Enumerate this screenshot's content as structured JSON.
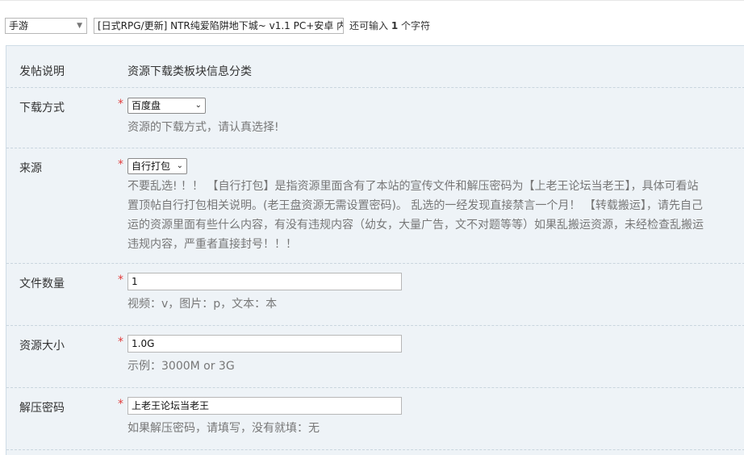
{
  "top": {
    "category_select": "手游",
    "title_value": "[日式RPG/更新] NTR纯爱陷阱地下城~ v1.1 PC+安卓 内i",
    "counter_prefix": "还可输入",
    "counter_number": "1",
    "counter_suffix": "个字符"
  },
  "fields": {
    "post_info": {
      "label": "发帖说明",
      "text": "资源下载类板块信息分类"
    },
    "download_method": {
      "label": "下载方式",
      "required": "*",
      "value": "百度盘",
      "hint": "资源的下载方式，请认真选择!"
    },
    "source": {
      "label": "来源",
      "required": "*",
      "value": "自行打包",
      "hint_lines": [
        "不要乱选! ！！ 【自行打包】是指资源里面含有了本站的宣传文件和解压密码为【上老王论坛当老王】，具体可看站",
        "置顶帖自行打包相关说明。(老王盘资源无需设置密码)。 乱选的一经发现直接禁言一个月！ 【转载搬运】，请先自己",
        "运的资源里面有些什么内容，有没有违规内容（幼女，大量广告，文不对题等等）如果乱搬运资源，未经检查乱搬运",
        "违规内容，严重者直接封号！！！"
      ]
    },
    "file_count": {
      "label": "文件数量",
      "required": "*",
      "value": "1",
      "hint": "视频：v，图片：p，文本：本"
    },
    "resource_size": {
      "label": "资源大小",
      "required": "*",
      "value": "1.0G",
      "hint": "示例：3000M or 3G"
    },
    "password": {
      "label": "解压密码",
      "required": "*",
      "value": "上老王论坛当老王",
      "hint": "如果解压密码，请填写，没有就填：无"
    }
  }
}
